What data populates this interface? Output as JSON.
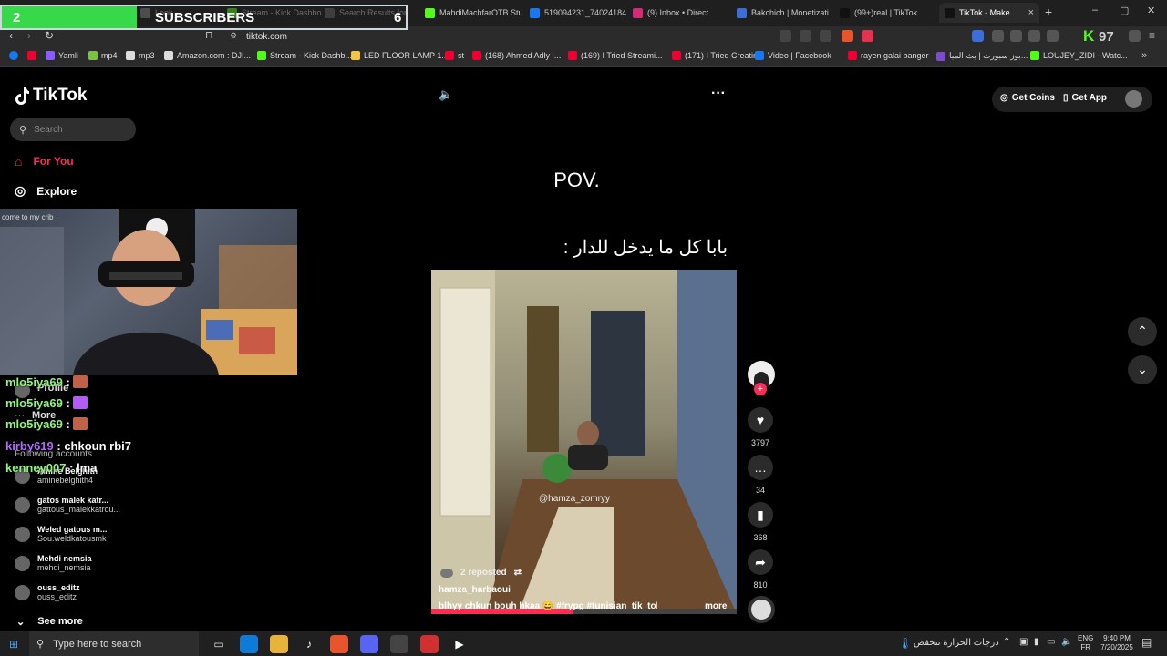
{
  "browser": {
    "tabs": [
      {
        "label": "Look...",
        "active": false
      },
      {
        "label": "Stream - Kick Dashbo...",
        "active": false
      },
      {
        "label": "Search Results for",
        "active": false
      },
      {
        "label": "MahdiMachfarOTB Stu...",
        "active": false
      },
      {
        "label": "519094231_740241840...",
        "active": false
      },
      {
        "label": "(9) Inbox • Direct",
        "active": false
      },
      {
        "label": "Bakchich | Monetizati...",
        "active": false
      },
      {
        "label": "(99+)real | TikTok",
        "active": false
      },
      {
        "label": "TikTok - Make",
        "active": true
      }
    ],
    "url": "tiktok.com",
    "bookmarks": [
      "Yamli",
      "mp4",
      "mp3",
      "Amazon.com : DJI...",
      "Stream - Kick Dashb...",
      "LED FLOOR LAMP 1...",
      "st",
      "(168) Ahmed Adly |...",
      "(169) I Tried Streami...",
      "(171) I Tried Creatin...",
      "Video | Facebook",
      "rayen galai banger",
      "بوز سبورت | بث المبا...",
      "LOUJEY_ZIDI - Watc..."
    ],
    "kick_count": "97"
  },
  "overlay": {
    "subs_current": "2",
    "subs_label": "SUBSCRIBERS",
    "subs_goal": "6",
    "webcam_sign": "come to my crib",
    "chat": [
      {
        "user": "mlo5iya69",
        "msg": "",
        "color": "#8ef57a",
        "emote": "#c0624a"
      },
      {
        "user": "mlo5iya69",
        "msg": "",
        "color": "#8ef57a",
        "emote": "#b35cf5"
      },
      {
        "user": "mlo5iya69",
        "msg": "",
        "color": "#8ef57a",
        "emote": "#c0624a"
      },
      {
        "user": "kirby619",
        "msg": "chkoun rbi7",
        "color": "#b36bff",
        "emote": ""
      },
      {
        "user": "kenney007",
        "msg": "lma",
        "color": "#8ef57a",
        "emote": ""
      }
    ]
  },
  "tiktok": {
    "logo": "TikTok",
    "search_placeholder": "Search",
    "nav": {
      "for_you": "For You",
      "explore": "Explore",
      "profile": "Profile",
      "more": "More"
    },
    "following_title": "Following accounts",
    "following": [
      {
        "name": "Amine Belghith",
        "handle": "aminebelghith4"
      },
      {
        "name": "gatos malek katr...",
        "handle": "gattous_malekkatrou..."
      },
      {
        "name": "Weled gatous m...",
        "handle": "Sou.weldkatousmk"
      },
      {
        "name": "Mehdi nemsia",
        "handle": "mehdi_nemsia"
      },
      {
        "name": "ouss_editz",
        "handle": "ouss_editz"
      }
    ],
    "see_more": "See more",
    "get_coins": "Get Coins",
    "get_app": "Get App",
    "caption_top": "POV.",
    "caption_arabic": "بابا كل ما يدخل للدار :",
    "watermark": "@hamza_zomryy",
    "reposted": "2 reposted",
    "author": "hamza_harbaoui",
    "description": "blhyy chkun bouh hkaa 😄 #frypg #tunisian_tik_tok ...",
    "more": "more",
    "likes": "3797",
    "comments": "34",
    "saves": "368",
    "shares": "810"
  },
  "taskbar": {
    "search_placeholder": "Type here to search",
    "weather": "درجات الحرارة تنخفض",
    "lang_top": "ENG",
    "lang_bottom": "FR",
    "time": "9:40 PM",
    "date": "7/20/2025"
  }
}
